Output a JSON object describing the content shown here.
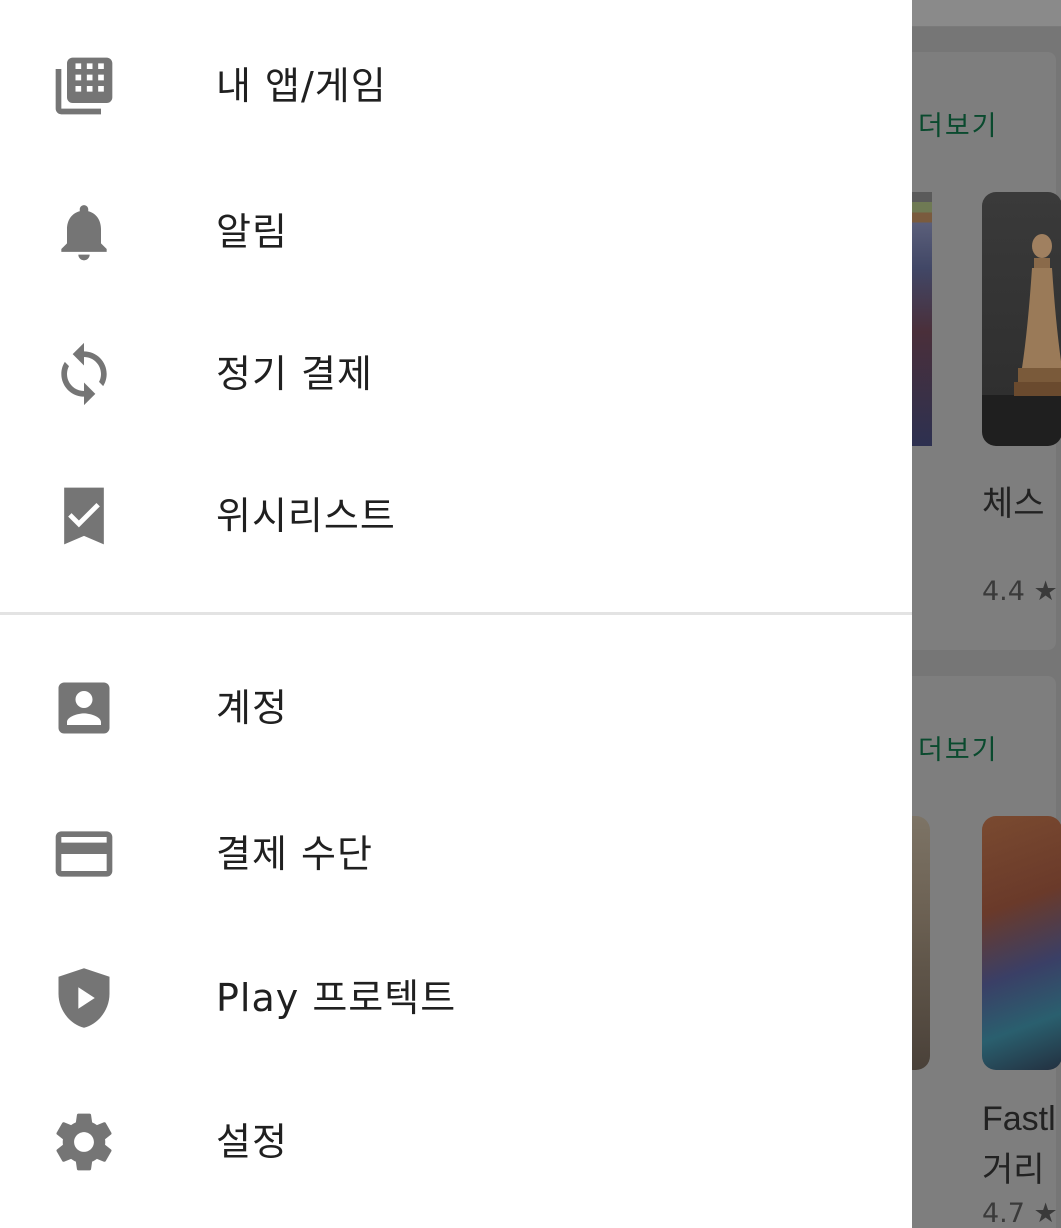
{
  "drawer": {
    "section1": [
      {
        "label": "내 앱/게임",
        "icon": "my-apps-icon"
      },
      {
        "label": "알림",
        "icon": "bell-icon"
      },
      {
        "label": "정기 결제",
        "icon": "sync-icon"
      },
      {
        "label": "위시리스트",
        "icon": "bookmark-check-icon"
      }
    ],
    "section2": [
      {
        "label": "계정",
        "icon": "account-box-icon"
      },
      {
        "label": "결제 수단",
        "icon": "credit-card-icon"
      },
      {
        "label": "Play 프로텍트",
        "icon": "shield-play-icon"
      },
      {
        "label": "설정",
        "icon": "gear-icon"
      }
    ],
    "icon_color": "#757575"
  },
  "background": {
    "cards": [
      {
        "more_label": "더보기",
        "app_title": "체스",
        "rating": "4.4"
      },
      {
        "more_label": "더보기",
        "app_title": "Fastl",
        "app_title_line2": "거리",
        "rating": "4.7"
      }
    ],
    "accent": "#0a4a2e"
  }
}
